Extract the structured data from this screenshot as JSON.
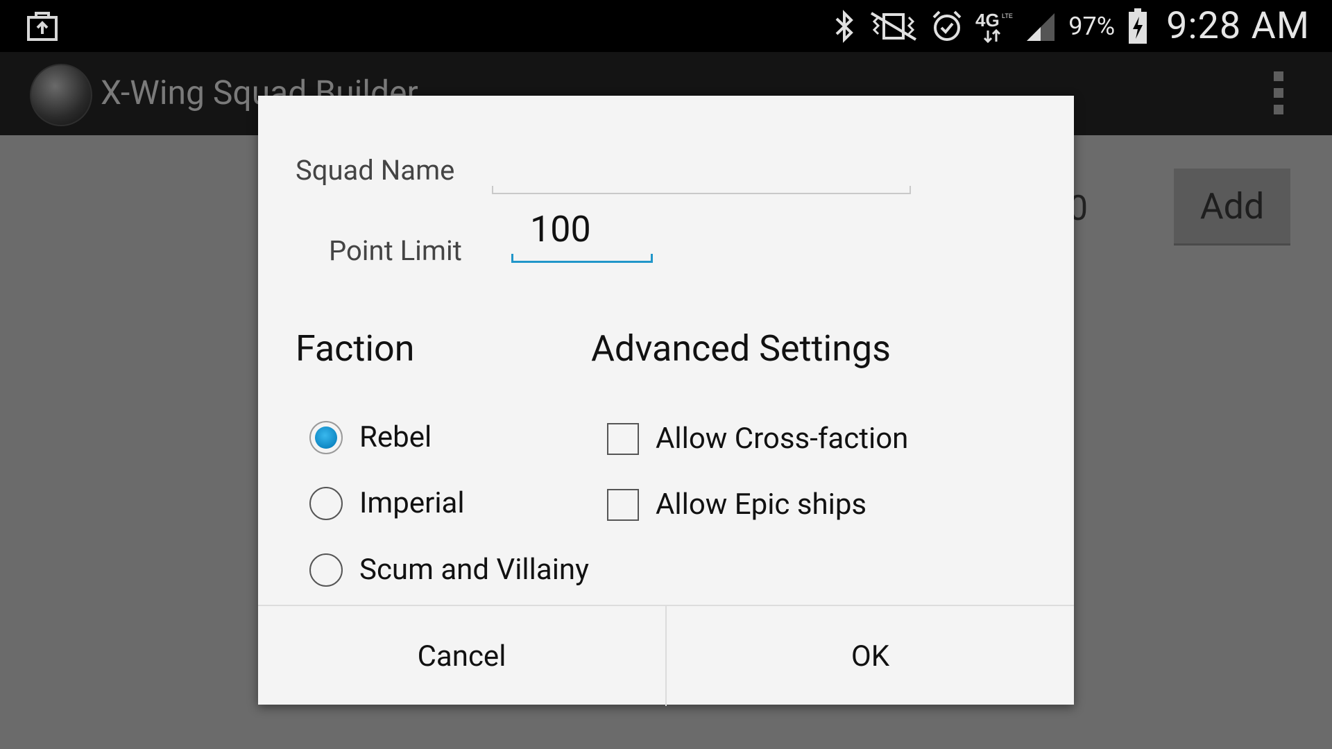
{
  "status_bar": {
    "icons": [
      "bag-icon",
      "bluetooth-icon",
      "vibrate-icon",
      "alarm-icon",
      "4g-lte-icon",
      "signal-icon",
      "battery-icon"
    ],
    "battery_percent": "97%",
    "time": "9:28 AM"
  },
  "app_bar": {
    "title": "X-Wing Squad Builder",
    "logo": "xwing-logo",
    "menu_icon": "overflow-menu-icon"
  },
  "background": {
    "count": "0",
    "add_button": "Add"
  },
  "dialog": {
    "squad_name_label": "Squad Name",
    "squad_name_value": "",
    "point_limit_label": "Point Limit",
    "point_limit_value": "100",
    "faction_heading": "Faction",
    "factions": [
      {
        "label": "Rebel",
        "checked": true
      },
      {
        "label": "Imperial",
        "checked": false
      },
      {
        "label": "Scum and Villainy",
        "checked": false
      }
    ],
    "advanced_heading": "Advanced Settings",
    "advanced": [
      {
        "label": "Allow Cross-faction",
        "checked": false
      },
      {
        "label": "Allow Epic ships",
        "checked": false
      }
    ],
    "cancel": "Cancel",
    "ok": "OK"
  },
  "colors": {
    "accent": "#2196c9",
    "dialog_bg": "#f4f4f4",
    "scrim": "#6b6b6b"
  }
}
